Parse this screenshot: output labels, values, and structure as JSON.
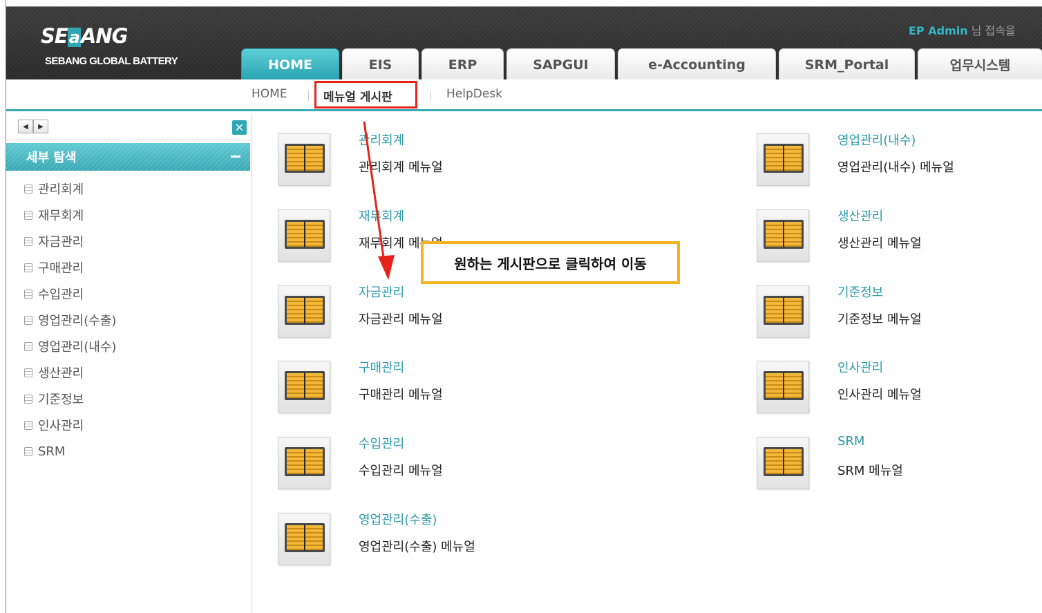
{
  "header": {
    "logo_main": "SE",
    "logo_accent": "a",
    "logo_end": "ANG",
    "logo_sub": "SEBANG GLOBAL BATTERY",
    "user_name": "EP Admin",
    "user_suffix": " 님 접속을 ",
    "tabs": [
      {
        "label": "HOME",
        "active": true
      },
      {
        "label": "EIS",
        "active": false
      },
      {
        "label": "ERP",
        "active": false
      },
      {
        "label": "SAPGUI",
        "active": false
      },
      {
        "label": "e-Accounting",
        "active": false
      },
      {
        "label": "SRM_Portal",
        "active": false
      },
      {
        "label": "업무시스템",
        "active": false
      }
    ]
  },
  "subnav": {
    "items": [
      "HOME",
      "메뉴얼 게시판",
      "HelpDesk"
    ],
    "active_index": 1
  },
  "sidebar": {
    "title": "세부 탐색",
    "close_icon": "close-icon",
    "items": [
      "관리회계",
      "재무회계",
      "자금관리",
      "구매관리",
      "수입관리",
      "영업관리(수출)",
      "영업관리(내수)",
      "생산관리",
      "기준정보",
      "인사관리",
      "SRM"
    ]
  },
  "boards": {
    "left": [
      {
        "title": "관리회계",
        "desc": "관리회계 메뉴얼"
      },
      {
        "title": "재무회계",
        "desc": "재무회계 메뉴얼"
      },
      {
        "title": "자금관리",
        "desc": "자금관리 메뉴얼"
      },
      {
        "title": "구매관리",
        "desc": "구매관리 메뉴얼"
      },
      {
        "title": "수입관리",
        "desc": "수입관리 메뉴얼"
      },
      {
        "title": "영업관리(수출)",
        "desc": "영업관리(수출) 메뉴얼"
      }
    ],
    "right": [
      {
        "title": "영업관리(내수)",
        "desc": "영업관리(내수) 메뉴얼"
      },
      {
        "title": "생산관리",
        "desc": "생산관리 메뉴얼"
      },
      {
        "title": "기준정보",
        "desc": "기준정보 메뉴얼"
      },
      {
        "title": "인사관리",
        "desc": "인사관리 메뉴얼"
      },
      {
        "title": "SRM",
        "desc": "SRM 메뉴얼"
      }
    ]
  },
  "annotation": {
    "callout_text": "원하는 게시판으로 클릭하여 이동",
    "highlight_color": "#e5231b",
    "callout_border_color": "#f2b31c"
  },
  "colors": {
    "accent": "#2fa8b4",
    "header_bg": "#333333",
    "link": "#2b9aa6"
  }
}
